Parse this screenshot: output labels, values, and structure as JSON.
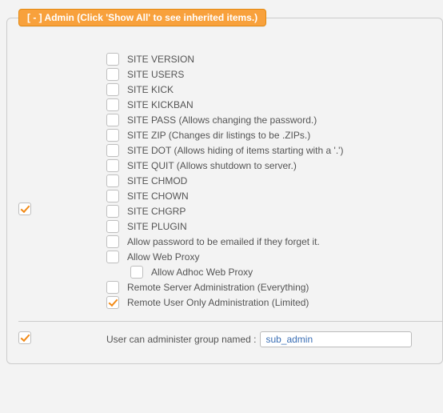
{
  "section": {
    "legend": "[ - ] Admin (Click 'Show All' to see inherited items.)"
  },
  "masterChecked": true,
  "items": [
    {
      "label": "SITE VERSION",
      "checked": false
    },
    {
      "label": "SITE USERS",
      "checked": false
    },
    {
      "label": "SITE KICK",
      "checked": false
    },
    {
      "label": "SITE KICKBAN",
      "checked": false
    },
    {
      "label": "SITE PASS (Allows changing the password.)",
      "checked": false
    },
    {
      "label": "SITE ZIP (Changes dir listings to be .ZIPs.)",
      "checked": false
    },
    {
      "label": "SITE DOT (Allows hiding of items starting with a '.')",
      "checked": false
    },
    {
      "label": "SITE QUIT (Allows shutdown to server.)",
      "checked": false
    },
    {
      "label": "SITE CHMOD",
      "checked": false
    },
    {
      "label": "SITE CHOWN",
      "checked": false
    },
    {
      "label": "SITE CHGRP",
      "checked": false
    },
    {
      "label": "SITE PLUGIN",
      "checked": false
    },
    {
      "label": "Allow password to be emailed if they forget it.",
      "checked": false
    },
    {
      "label": "Allow Web Proxy",
      "checked": false
    },
    {
      "label": "Allow Adhoc Web Proxy",
      "checked": false,
      "indent": true
    },
    {
      "label": "Remote Server Administration (Everything)",
      "checked": false
    },
    {
      "label": "Remote User Only Administration (Limited)",
      "checked": true
    }
  ],
  "group": {
    "masterChecked": true,
    "label": "User can administer group named :",
    "value": "sub_admin"
  }
}
